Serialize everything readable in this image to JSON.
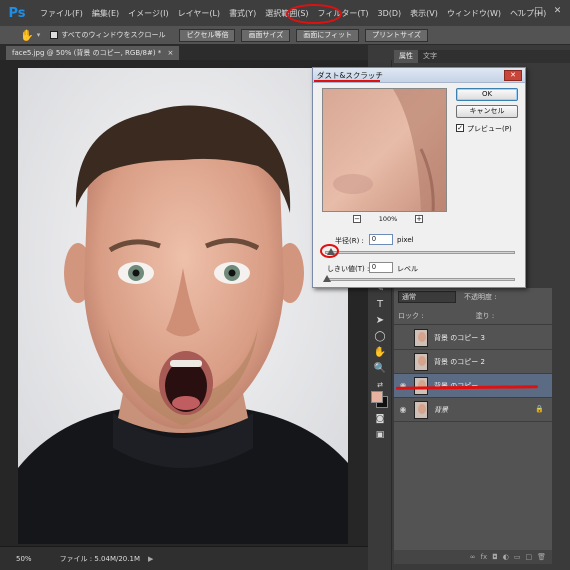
{
  "app": {
    "logo": "Ps"
  },
  "menu": [
    "ファイル(F)",
    "編集(E)",
    "イメージ(I)",
    "レイヤー(L)",
    "書式(Y)",
    "選択範囲(S)",
    "フィルター(T)",
    "3D(D)",
    "表示(V)",
    "ウィンドウ(W)",
    "ヘルプ(H)"
  ],
  "window_controls": {
    "minimize": "–",
    "restore": "□",
    "close": "✕"
  },
  "options_bar": {
    "scroll_all_label": "すべてのウィンドウをスクロール",
    "btn_actual_pixels": "ピクセル等倍",
    "btn_fit_screen": "画面サイズ",
    "btn_fill_screen": "画面にフィット",
    "btn_print_size": "プリントサイズ"
  },
  "document": {
    "tab_title": "face5.jpg @ 50% (背景 のコピー, RGB/8#) *",
    "tab_close": "×"
  },
  "status": {
    "zoom": "50%",
    "file_info": "ファイル : 5.04M/20.1M"
  },
  "panel_tabs": {
    "properties": "属性",
    "character": "文字"
  },
  "layers_panel": {
    "blend_mode": "通常",
    "opacity_label": "不透明度 :",
    "lock_label": "ロック :",
    "fill_label": "塗り :",
    "layers": [
      {
        "name": "背景 のコピー 3",
        "visible": false,
        "selected": false,
        "locked": false
      },
      {
        "name": "背景 のコピー 2",
        "visible": false,
        "selected": false,
        "locked": false
      },
      {
        "name": "背景 のコピー",
        "visible": true,
        "selected": true,
        "locked": false
      },
      {
        "name": "背景",
        "visible": true,
        "selected": false,
        "locked": true
      }
    ]
  },
  "dialog": {
    "title": "ダスト&スクラッチ",
    "close": "✕",
    "ok_label": "OK",
    "cancel_label": "キャンセル",
    "preview_label": "プレビュー(P)",
    "preview_checked": true,
    "zoom_percent": "100%",
    "zoom_minus": "−",
    "zoom_plus": "+",
    "radius_label": "半径(R) :",
    "radius_value": "0",
    "radius_unit": "pixel",
    "threshold_label": "しきい値(T) :",
    "threshold_value": "0",
    "threshold_unit": "レベル"
  },
  "colors": {
    "annotation_red": "#e01010",
    "foreground_swatch": "#e7b2a0",
    "background_swatch": "#111111",
    "selected_layer": "#5b6b83"
  }
}
